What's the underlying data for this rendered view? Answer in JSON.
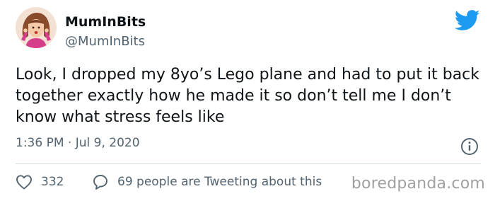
{
  "tweet": {
    "display_name": "MumInBits",
    "handle": "@MumInBits",
    "text": "Look, I dropped my 8yo’s Lego plane and had to put it back together exactly how he made it so don’t tell me I don’t know what stress feels like",
    "timestamp": "1:36 PM · Jul 9, 2020",
    "likes": "332",
    "conversation_label": "69 people are Tweeting about this"
  },
  "icons": {
    "brand": "twitter-bird-icon",
    "info": "info-icon",
    "like": "heart-icon",
    "reply": "speech-bubble-icon"
  },
  "colors": {
    "brand_blue": "#1d9bf0",
    "text_primary": "#0f1419",
    "text_secondary": "#536471",
    "divider": "#cfd9de",
    "watermark": "#a0a0a0"
  },
  "watermark": "boredpanda.com"
}
